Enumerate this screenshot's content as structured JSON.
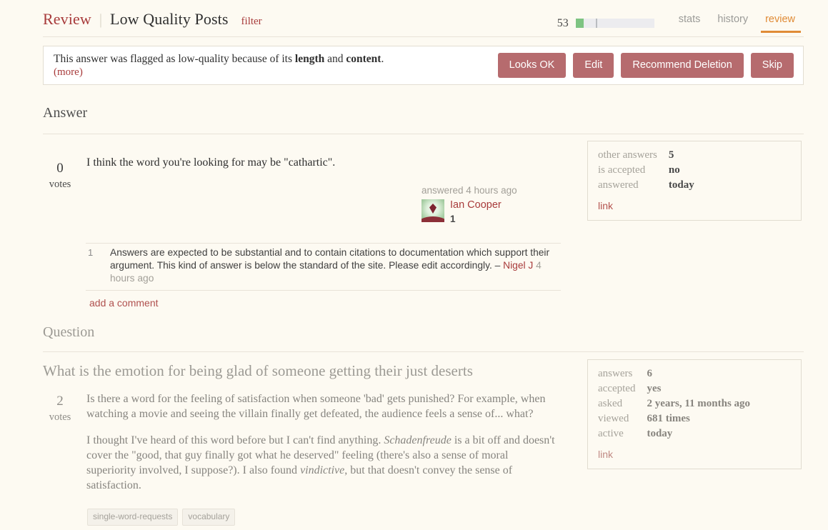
{
  "header": {
    "brand": "Review",
    "separator": "|",
    "title": "Low Quality Posts",
    "filter_label": "filter",
    "progress_count": "53",
    "tabs": [
      {
        "label": "stats",
        "active": false
      },
      {
        "label": "history",
        "active": false
      },
      {
        "label": "review",
        "active": true
      }
    ],
    "accent_color": "#e08b36",
    "brand_color": "#a83b3b"
  },
  "banner": {
    "text_prefix": "This answer was flagged as low-quality because of its ",
    "reason_one": "length",
    "text_middle": " and ",
    "reason_two": "content",
    "text_suffix": ".",
    "more_label": "(more)",
    "buttons": [
      {
        "label": "Looks OK",
        "name": "looks-ok-button"
      },
      {
        "label": "Edit",
        "name": "edit-button"
      },
      {
        "label": "Recommend Deletion",
        "name": "recommend-deletion-button"
      },
      {
        "label": "Skip",
        "name": "skip-button"
      }
    ],
    "button_color": "#b66b6e"
  },
  "answer_section": {
    "heading": "Answer",
    "votes": "0",
    "votes_label": "votes",
    "body": "I think the word you're looking for may be \"cathartic\".",
    "user": {
      "when": "answered 4 hours ago",
      "name": "Ian Cooper",
      "reputation": "1"
    },
    "stats": {
      "rows": [
        {
          "key": "other answers",
          "value": "5"
        },
        {
          "key": "is accepted",
          "value": "no"
        },
        {
          "key": "answered",
          "value": "today"
        }
      ],
      "link_label": "link"
    },
    "comments": [
      {
        "score": "1",
        "text": "Answers are expected to be substantial and to contain citations to documentation which support their argument. This kind of answer is below the standard of the site. Please edit accordingly. – ",
        "user": "Nigel J",
        "when": " 4 hours ago"
      }
    ],
    "add_comment_label": "add a comment"
  },
  "question_section": {
    "heading": "Question",
    "title": "What is the emotion for being glad of someone getting their just deserts",
    "votes": "2",
    "votes_label": "votes",
    "paragraph_1_a": "Is there a word for the feeling of satisfaction when someone 'bad' gets punished? For example, when watching a movie and seeing the villain finally get defeated, the audience feels a sense of... what?",
    "paragraph_2_a": "I thought I've heard of this word before but I can't find anything. ",
    "paragraph_2_italic_1": "Schadenfreude",
    "paragraph_2_b": " is a bit off and doesn't cover the \"good, that guy finally got what he deserved\" feeling (there's also a sense of moral superiority involved, I suppose?). I also found ",
    "paragraph_2_italic_2": "vindictive",
    "paragraph_2_c": ", but that doesn't convey the sense of satisfaction.",
    "stats": {
      "rows": [
        {
          "key": "answers",
          "value": "6"
        },
        {
          "key": "accepted",
          "value": "yes"
        },
        {
          "key": "asked",
          "value": "2 years, 11 months ago"
        },
        {
          "key": "viewed",
          "value": "681 times"
        },
        {
          "key": "active",
          "value": "today"
        }
      ],
      "link_label": "link"
    },
    "tags": [
      "single-word-requests",
      "vocabulary"
    ]
  }
}
